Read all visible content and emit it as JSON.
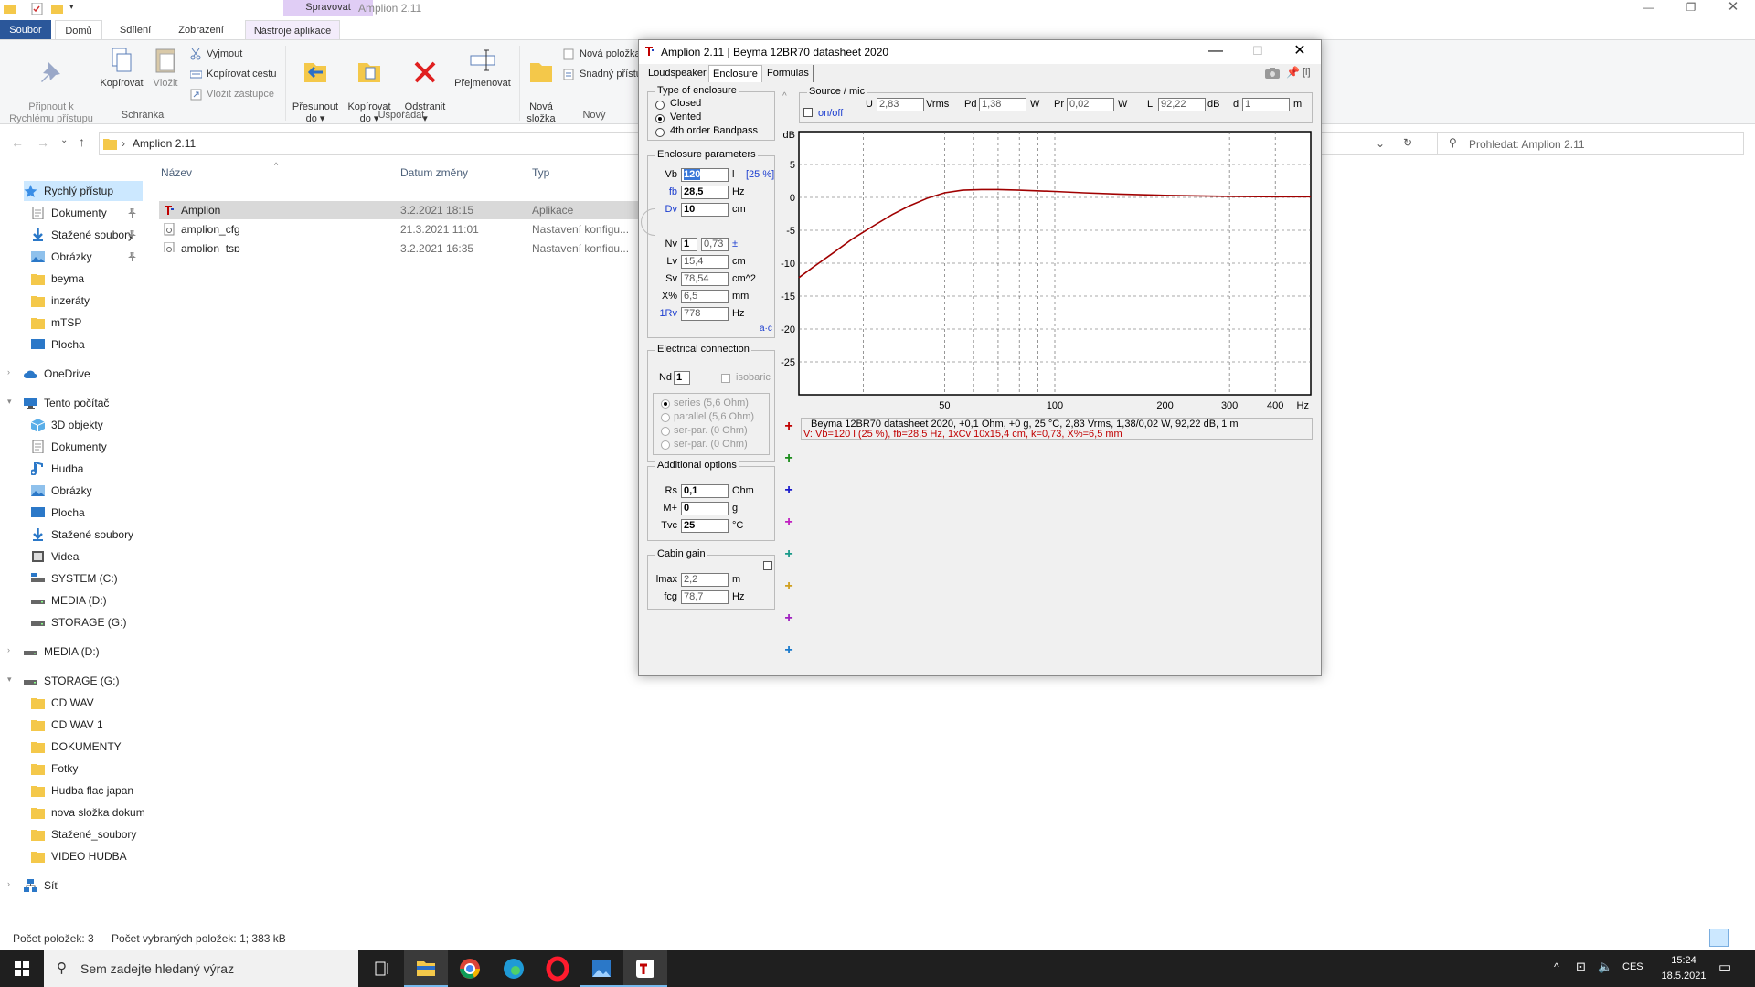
{
  "explorer": {
    "title": "Amplion 2.11",
    "context_tab": "Spravovat",
    "tabs": [
      "Soubor",
      "Domů",
      "Sdílení",
      "Zobrazení",
      "Nástroje aplikace"
    ],
    "ribbon": {
      "pin": "Připnout k\nRychlému přístupu",
      "copy": "Kopírovat",
      "paste": "Vložit",
      "cut": "Vyjmout",
      "copy_path": "Kopírovat cestu",
      "paste_shortcut": "Vložit zástupce",
      "group_clipboard": "Schránka",
      "move_to": "Přesunout\ndo ▾",
      "copy_to": "Kopírovat\ndo ▾",
      "delete": "Odstranit\n▾",
      "rename": "Přejmenovat",
      "group_organize": "Uspořádat",
      "new_folder": "Nová\nsložka",
      "new_item": "Nová položka",
      "easy_access": "Snadný přístup",
      "group_new": "Nový"
    },
    "address": "Amplion 2.11",
    "search_placeholder": "Prohledat: Amplion 2.11",
    "columns": {
      "name": "Název",
      "date": "Datum změny",
      "type": "Typ"
    },
    "files": [
      {
        "name": "Amplion",
        "date": "3.2.2021 18:15",
        "type": "Aplikace",
        "selected": true
      },
      {
        "name": "amplion_cfg",
        "date": "21.3.2021 11:01",
        "type": "Nastavení konfigu..."
      },
      {
        "name": "amplion_tsp",
        "date": "3.2.2021 16:35",
        "type": "Nastavení konfigu..."
      }
    ],
    "nav": {
      "quick_access": "Rychlý přístup",
      "quick_items": [
        "Dokumenty",
        "Stažené soubory",
        "Obrázky",
        "beyma",
        "inzeráty",
        "mTSP",
        "Plocha"
      ],
      "onedrive": "OneDrive",
      "this_pc": "Tento počítač",
      "pc_items": [
        "3D objekty",
        "Dokumenty",
        "Hudba",
        "Obrázky",
        "Plocha",
        "Stažené soubory",
        "Videa",
        "SYSTEM (C:)",
        "MEDIA (D:)",
        "STORAGE (G:)"
      ],
      "media_d": "MEDIA (D:)",
      "storage_g": "STORAGE (G:)",
      "storage_items": [
        "CD WAV",
        "CD WAV 1",
        "DOKUMENTY",
        "Fotky",
        "Hudba flac japan",
        "nova složka dokum",
        "Stažené_soubory",
        "VIDEO HUDBA"
      ],
      "network": "Síť"
    },
    "status_items": "Počet položek: 3",
    "status_selected": "Počet vybraných položek: 1; 383 kB"
  },
  "taskbar": {
    "search_placeholder": "Sem zadejte hledaný výraz",
    "time": "15:24",
    "date": "18.5.2021",
    "lang": "CES"
  },
  "amplion": {
    "title": "Amplion 2.11 | Beyma 12BR70 datasheet 2020",
    "tabs": [
      "Loudspeaker",
      "Enclosure",
      "Formulas"
    ],
    "enclosure_type": {
      "title": "Type of enclosure",
      "options": [
        "Closed",
        "Vented",
        "4th order Bandpass"
      ],
      "selected": "Vented"
    },
    "params": {
      "title": "Enclosure parameters",
      "vb_label": "Vb",
      "vb": "120",
      "vb_unit": "l",
      "vb_pct": "[25 %]",
      "fb_label": "fb",
      "fb": "28,5",
      "fb_unit": "Hz",
      "dv_label": "Dv",
      "dv": "10",
      "dv_unit": "cm",
      "nv_label": "Nv",
      "nv": "1",
      "k": "0,73",
      "k_sym": "±",
      "lv_label": "Lv",
      "lv": "15,4",
      "lv_unit": "cm",
      "sv_label": "Sv",
      "sv": "78,54",
      "sv_unit": "cm^2",
      "xpct_label": "X%",
      "xpct": "6,5",
      "xpct_unit": "mm",
      "frv_label": "1Rv",
      "frv": "778",
      "frv_unit": "Hz",
      "ac_link": "a·c"
    },
    "electrical": {
      "title": "Electrical connection",
      "nd_label": "Nd",
      "nd": "1",
      "isobaric": "isobaric",
      "options": [
        "series (5,6 Ohm)",
        "parallel (5,6 Ohm)",
        "ser-par. (0 Ohm)",
        "ser-par. (0 Ohm)"
      ]
    },
    "additional": {
      "title": "Additional options",
      "rs_label": "Rs",
      "rs": "0,1",
      "rs_unit": "Ohm",
      "m_label": "M+",
      "m": "0",
      "m_unit": "g",
      "tvc_label": "Tvc",
      "tvc": "25",
      "tvc_unit": "°C"
    },
    "cabin": {
      "title": "Cabin gain",
      "lmax_label": "lmax",
      "lmax": "2,2",
      "lmax_unit": "m",
      "fcg_label": "fcg",
      "fcg": "78,7",
      "fcg_unit": "Hz"
    },
    "source": {
      "title": "Source / mic",
      "onoff": "on/off",
      "u_label": "U",
      "u": "2,83",
      "u_unit": "Vrms",
      "pd_label": "Pd",
      "pd": "1,38",
      "pd_unit": "W",
      "pr_label": "Pr",
      "pr": "0,02",
      "pr_unit": "W",
      "l_label": "L",
      "l": "92,22",
      "l_unit": "dB",
      "d_label": "d",
      "d": "1",
      "d_unit": "m"
    },
    "legend_line1": "Beyma 12BR70 datasheet 2020, +0,1 Ohm, +0 g, 25 °C, 2,83 Vrms, 1,38/0,02 W, 92,22 dB, 1 m",
    "legend_line2": "V: Vb=120 l (25 %), fb=28,5 Hz, 1xCv 10x15,4 cm, k=0,73, X%=6,5 mm",
    "plus_colors": [
      "#c00000",
      "#1a8c1a",
      "#1a1acc",
      "#c020c0",
      "#1a9a8a",
      "#d0a020",
      "#a020c0",
      "#1a7acc"
    ],
    "curve_color": "#a00000"
  },
  "chart_data": {
    "type": "line",
    "xlabel": "Hz",
    "ylabel": "dB",
    "x_scale": "log",
    "xlim": [
      20,
      500
    ],
    "ylim": [
      -30,
      10
    ],
    "x_ticks": [
      50,
      100,
      200,
      300,
      400
    ],
    "y_ticks": [
      5,
      0,
      -5,
      -10,
      -15,
      -20,
      -25
    ],
    "grid": true,
    "series": [
      {
        "x": [
          20,
          22,
          25,
          28,
          32,
          36,
          40,
          45,
          50,
          56,
          63,
          70,
          80,
          100,
          120,
          150,
          200,
          300,
          400,
          500
        ],
        "values": [
          -12.2,
          -10.5,
          -8.3,
          -6.3,
          -4.3,
          -2.6,
          -1.3,
          -0.1,
          0.7,
          1.1,
          1.2,
          1.2,
          1.1,
          0.9,
          0.7,
          0.5,
          0.3,
          0.15,
          0.1,
          0.1
        ]
      }
    ]
  }
}
